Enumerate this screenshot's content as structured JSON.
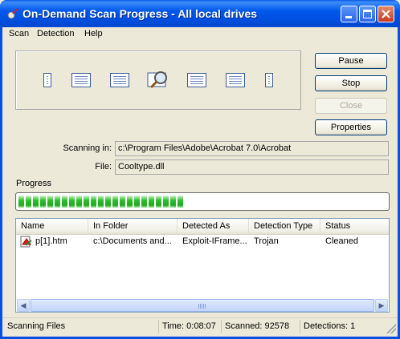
{
  "window": {
    "title": "On-Demand Scan Progress - All local drives"
  },
  "menu": [
    "Scan",
    "Detection",
    "Help"
  ],
  "buttons": {
    "pause": "Pause",
    "stop": "Stop",
    "close": "Close",
    "properties": "Properties"
  },
  "fields": {
    "scanning_in_label": "Scanning in:",
    "scanning_in_value": "c:\\Program Files\\Adobe\\Acrobat 7.0\\Acrobat",
    "file_label": "File:",
    "file_value": "Cooltype.dll"
  },
  "progress": {
    "label": "Progress",
    "fraction": 0.45
  },
  "list": {
    "columns": [
      "Name",
      "In Folder",
      "Detected As",
      "Detection Type",
      "Status"
    ],
    "rows": [
      {
        "name": "p[1].htm",
        "folder": "c:\\Documents and...",
        "detected_as": "Exploit-IFrame...",
        "type": "Trojan",
        "status": "Cleaned"
      }
    ]
  },
  "status": {
    "activity": "Scanning Files",
    "time": "Time: 0:08:07",
    "scanned": "Scanned: 92578",
    "detections": "Detections: 1"
  }
}
